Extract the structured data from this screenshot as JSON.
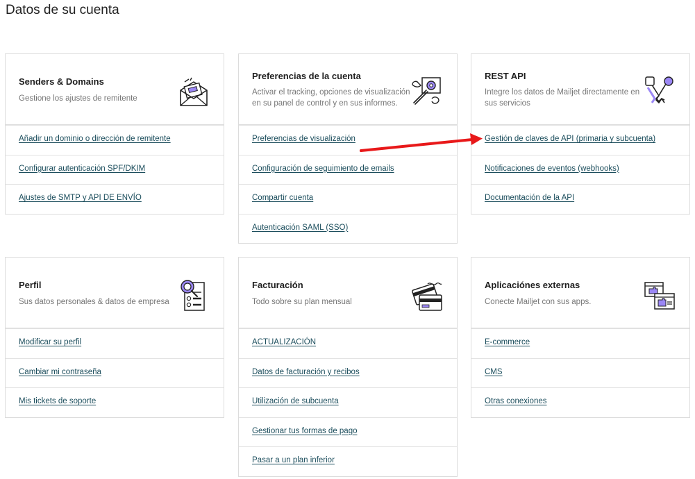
{
  "page": {
    "title": "Datos de su cuenta"
  },
  "cards": {
    "senders": {
      "title": "Senders & Domains",
      "subtitle": "Gestione los ajustes de remitente",
      "icon": "envelope-icon",
      "links": [
        "Añadir un dominio o dirección de remitente",
        "Configurar autenticación SPF/DKIM",
        "Ajustes de SMTP y API DE ENVÍO"
      ]
    },
    "preferences": {
      "title": "Preferencias de la cuenta",
      "subtitle": "Activar el tracking, opciones de visualización en su panel de control y en sus informes.",
      "icon": "wrench-gear-icon",
      "links": [
        "Preferencias de visualización",
        "Configuración de seguimiento de emails",
        "Compartir cuenta",
        "Autenticación SAML (SSO)"
      ]
    },
    "restapi": {
      "title": "REST API",
      "subtitle": "Integre los datos de Mailjet directamente en sus servicios",
      "icon": "keys-icon",
      "links": [
        "Gestión de claves de API (primaria y subcuenta)",
        "Notificaciones de eventos (webhooks)",
        "Documentación de la API"
      ]
    },
    "profile": {
      "title": "Perfil",
      "subtitle": "Sus datos personales & datos de empresa",
      "icon": "profile-search-icon",
      "links": [
        "Modificar su perfil",
        "Cambiar mi contraseña",
        "Mis tickets de soporte"
      ]
    },
    "billing": {
      "title": "Facturación",
      "subtitle": "Todo sobre su plan mensual",
      "icon": "credit-card-icon",
      "links": [
        "ACTUALIZACIÓN",
        "Datos de facturación y recibos",
        "Utilización de subcuenta",
        "Gestionar tus formas de pago",
        "Pasar a un plan inferior"
      ]
    },
    "apps": {
      "title": "Aplicaciónes externas",
      "subtitle": "Conecte Mailjet con sus apps.",
      "icon": "puzzle-windows-icon",
      "links": [
        "E-commerce",
        "CMS",
        "Otras conexiones"
      ]
    }
  },
  "colors": {
    "link": "#1b4d5c",
    "accent": "#9b87f5",
    "arrow": "#e8191a",
    "border": "#dcdcdc"
  }
}
